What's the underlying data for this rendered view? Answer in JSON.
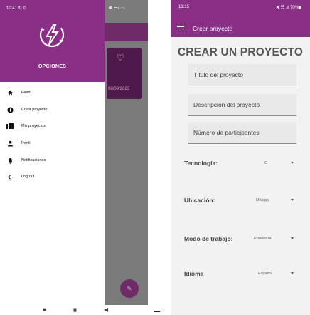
{
  "left_screen": {
    "status_bar": {
      "time": "10:41",
      "time_icons": "↻ ⊙",
      "right_icons": "❖ ☰ıl ▭"
    },
    "drawer": {
      "title": "OPCIONES",
      "items": [
        {
          "label": "Feed",
          "icon": "home-icon"
        },
        {
          "label": "Crear proyecto",
          "icon": "add-circle-icon"
        },
        {
          "label": "Mis proyectos",
          "icon": "folder-icon"
        },
        {
          "label": "Perfil",
          "icon": "person-icon"
        },
        {
          "label": "Notificaciones",
          "icon": "bell-icon"
        },
        {
          "label": "Log out",
          "icon": "back-arrow-icon"
        }
      ]
    },
    "background": {
      "card_date": "08/03/2023",
      "fab_icon": "edit-icon"
    },
    "nav_bar": {
      "back": "◀",
      "home": "◉",
      "recents": "■"
    }
  },
  "right_screen": {
    "status_bar": {
      "time": "13:15",
      "right_icons": "✖ ☵ .ıl 70%▮"
    },
    "app_bar": {
      "title": "Crear proyecto",
      "menu_icon": "hamburger-menu-icon"
    },
    "heading": "CREAR UN PROYECTO",
    "fields": {
      "title_placeholder": "Título del proyecto",
      "description_placeholder": "Descripción del proyecto",
      "participants_placeholder": "Número de participantes"
    },
    "selects": [
      {
        "label": "Tecnología:",
        "value": "C"
      },
      {
        "label": "Ubicación:",
        "value": "Málaga"
      },
      {
        "label": "Modo de trabajo:",
        "value": "Presencial"
      },
      {
        "label": "Idioma",
        "value": "Español"
      }
    ]
  },
  "colors": {
    "primary": "#8a2f86",
    "primary_dark": "#6e2b68",
    "scrim": "#7a7a7a",
    "surface": "#f2f2f2"
  }
}
